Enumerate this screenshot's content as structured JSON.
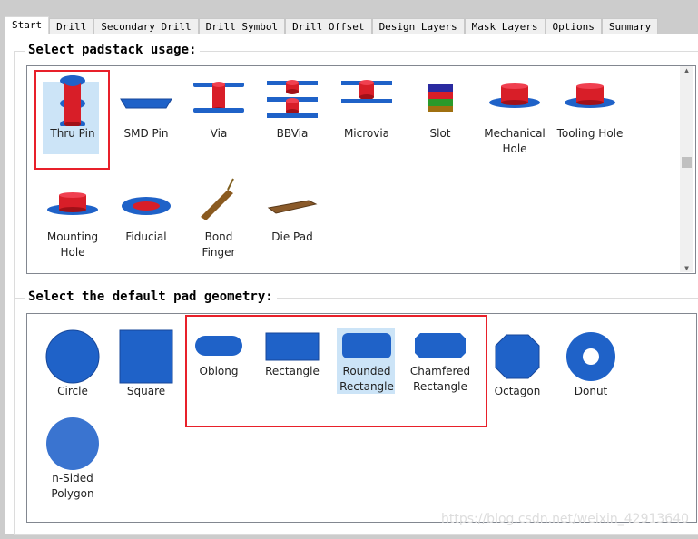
{
  "tabs": [
    "Start",
    "Drill",
    "Secondary Drill",
    "Drill Symbol",
    "Drill Offset",
    "Design Layers",
    "Mask Layers",
    "Options",
    "Summary"
  ],
  "active_tab": "Start",
  "usage": {
    "title": "Select padstack usage:",
    "selected": "Thru Pin",
    "items": [
      {
        "label": "Thru Pin",
        "icon": "thru-pin-icon"
      },
      {
        "label": "SMD Pin",
        "icon": "smd-pin-icon"
      },
      {
        "label": "Via",
        "icon": "via-icon"
      },
      {
        "label": "BBVia",
        "icon": "bbvia-icon"
      },
      {
        "label": "Microvia",
        "icon": "microvia-icon"
      },
      {
        "label": "Slot",
        "icon": "slot-icon"
      },
      {
        "label": "Mechanical Hole",
        "icon": "mechanical-hole-icon"
      },
      {
        "label": "Tooling Hole",
        "icon": "tooling-hole-icon"
      },
      {
        "label": "Mounting Hole",
        "icon": "mounting-hole-icon"
      },
      {
        "label": "Fiducial",
        "icon": "fiducial-icon"
      },
      {
        "label": "Bond Finger",
        "icon": "bond-finger-icon"
      },
      {
        "label": "Die Pad",
        "icon": "die-pad-icon"
      }
    ]
  },
  "geometry": {
    "title": "Select the default pad geometry:",
    "selected": "Rounded Rectangle",
    "items": [
      {
        "label": "Circle",
        "icon": "circle-icon"
      },
      {
        "label": "Square",
        "icon": "square-icon"
      },
      {
        "label": "Oblong",
        "icon": "oblong-icon"
      },
      {
        "label": "Rectangle",
        "icon": "rectangle-icon"
      },
      {
        "label": "Rounded Rectangle",
        "icon": "rounded-rectangle-icon"
      },
      {
        "label": "Chamfered Rectangle",
        "icon": "chamfered-rectangle-icon"
      },
      {
        "label": "Octagon",
        "icon": "octagon-icon"
      },
      {
        "label": "Donut",
        "icon": "donut-icon"
      },
      {
        "label": "n-Sided Polygon",
        "icon": "polygon-icon"
      }
    ]
  },
  "colors": {
    "pad_blue": "#1f62c8",
    "barrel_red": "#d81e28",
    "highlight": "#e8202a"
  },
  "watermark": "https://blog.csdn.net/weixin_42913640"
}
